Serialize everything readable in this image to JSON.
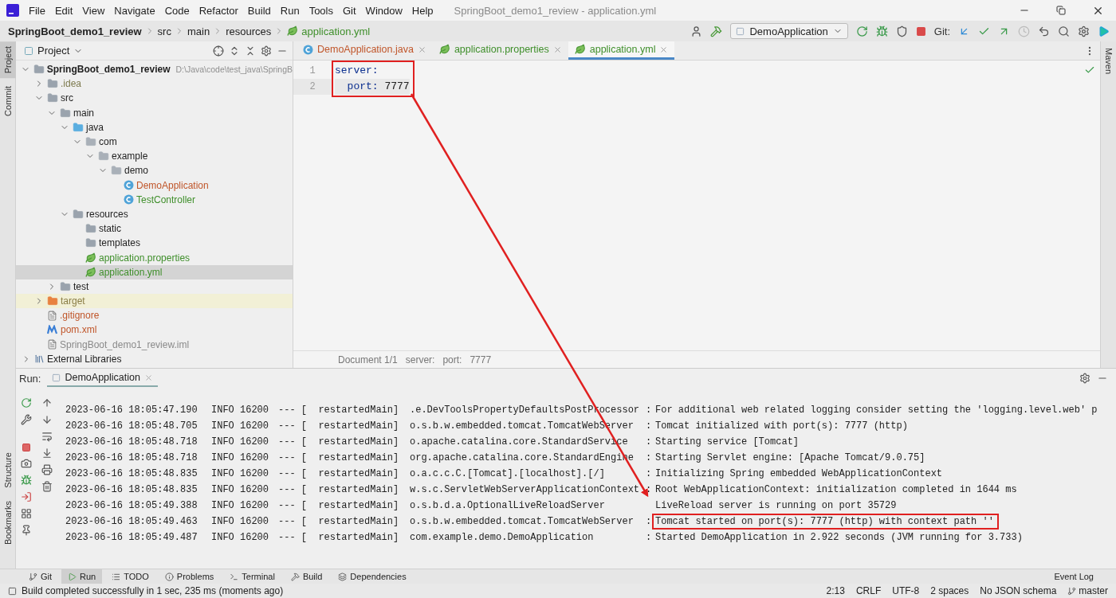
{
  "menu": [
    "File",
    "Edit",
    "View",
    "Navigate",
    "Code",
    "Refactor",
    "Build",
    "Run",
    "Tools",
    "Git",
    "Window",
    "Help"
  ],
  "window": {
    "title": "SpringBoot_demo1_review - application.yml"
  },
  "breadcrumb": [
    {
      "label": "SpringBoot_demo1_review",
      "kind": "project"
    },
    {
      "label": "src",
      "kind": "folder"
    },
    {
      "label": "main",
      "kind": "folder"
    },
    {
      "label": "resources",
      "kind": "folder"
    },
    {
      "label": "application.yml",
      "kind": "config"
    }
  ],
  "toolbar": {
    "run_config": "DemoApplication",
    "git_label": "Git:"
  },
  "left_tools": [
    {
      "label": "Project",
      "selected": true
    },
    {
      "label": "Commit",
      "selected": false
    }
  ],
  "left_tools_bottom": [
    {
      "label": "Structure"
    },
    {
      "label": "Bookmarks"
    }
  ],
  "right_tools": [
    {
      "label": "Maven"
    }
  ],
  "project_panel": {
    "title": "Project",
    "tree": [
      {
        "name": "SpringBoot_demo1_review",
        "path": "D:\\Java\\code\\test_java\\SpringB",
        "kind": "module",
        "expanded": true,
        "selected": false,
        "children": [
          {
            "name": ".idea",
            "kind": "folder",
            "color": "#7d7a4e",
            "expanded": false,
            "selected": false
          },
          {
            "name": "src",
            "kind": "folder",
            "expanded": true,
            "selected": false,
            "children": [
              {
                "name": "main",
                "kind": "folder",
                "expanded": true,
                "selected": false,
                "children": [
                  {
                    "name": "java",
                    "kind": "source",
                    "expanded": true,
                    "selected": false,
                    "children": [
                      {
                        "name": "com",
                        "kind": "package",
                        "expanded": true,
                        "selected": false,
                        "children": [
                          {
                            "name": "example",
                            "kind": "package",
                            "expanded": true,
                            "selected": false,
                            "children": [
                              {
                                "name": "demo",
                                "kind": "package",
                                "expanded": true,
                                "selected": false,
                                "children": [
                                  {
                                    "name": "DemoApplication",
                                    "kind": "class",
                                    "color": "#c0562a",
                                    "selected": false
                                  },
                                  {
                                    "name": "TestController",
                                    "kind": "class",
                                    "color": "#3f8f2b",
                                    "selected": false
                                  }
                                ]
                              }
                            ]
                          }
                        ]
                      }
                    ]
                  },
                  {
                    "name": "resources",
                    "kind": "resources",
                    "expanded": true,
                    "selected": false,
                    "children": [
                      {
                        "name": "static",
                        "kind": "folder",
                        "selected": false
                      },
                      {
                        "name": "templates",
                        "kind": "folder",
                        "selected": false
                      },
                      {
                        "name": "application.properties",
                        "kind": "config",
                        "color": "#3f8f2b",
                        "selected": false
                      },
                      {
                        "name": "application.yml",
                        "kind": "config",
                        "color": "#3f8f2b",
                        "selected": true
                      }
                    ]
                  }
                ]
              },
              {
                "name": "test",
                "kind": "folder",
                "expanded": false,
                "selected": false
              }
            ]
          },
          {
            "name": "target",
            "kind": "excluded",
            "color": "#8a7d45",
            "expanded": false,
            "selected": false
          },
          {
            "name": ".gitignore",
            "kind": "ignore",
            "color": "#c0562a",
            "selected": false
          },
          {
            "name": "pom.xml",
            "kind": "maven",
            "color": "#c0562a",
            "selected": false
          },
          {
            "name": "SpringBoot_demo1_review.iml",
            "kind": "iml",
            "color": "#8a8a8a",
            "selected": false
          }
        ]
      },
      {
        "name": "External Libraries",
        "kind": "libraries",
        "expanded": false,
        "selected": false
      }
    ]
  },
  "editor_tabs": [
    {
      "label": "DemoApplication.java",
      "kind": "class",
      "color": "#c0562a",
      "selected": false
    },
    {
      "label": "application.properties",
      "kind": "config",
      "color": "#3f8f2b",
      "selected": false
    },
    {
      "label": "application.yml",
      "kind": "config",
      "color": "#3f8f2b",
      "selected": true
    }
  ],
  "editor": {
    "lines": [
      {
        "number": "1",
        "key": "server:",
        "current": false
      },
      {
        "number": "2",
        "key": "  port:",
        "value": " 7777",
        "current": true
      }
    ],
    "highlighted": true,
    "path": [
      "Document 1/1",
      "server:",
      "port:",
      "7777"
    ]
  },
  "run_panel": {
    "label": "Run:",
    "tab": "DemoApplication",
    "rows": [
      {
        "time": "2023-06-16 18:05:47.190",
        "level": "INFO",
        "pid": "16200",
        "thread": "--- [  restartedMain]",
        "logger": ".e.DevToolsPropertyDefaultsPostProcessor",
        "sep": ":",
        "message": "For additional web related logging consider setting the 'logging.level.web' p",
        "highlighted": false
      },
      {
        "time": "2023-06-16 18:05:48.705",
        "level": "INFO",
        "pid": "16200",
        "thread": "--- [  restartedMain]",
        "logger": "o.s.b.w.embedded.tomcat.TomcatWebServer",
        "sep": ":",
        "message": "Tomcat initialized with port(s): 7777 (http)",
        "highlighted": false
      },
      {
        "time": "2023-06-16 18:05:48.718",
        "level": "INFO",
        "pid": "16200",
        "thread": "--- [  restartedMain]",
        "logger": "o.apache.catalina.core.StandardService",
        "sep": ":",
        "message": "Starting service [Tomcat]",
        "highlighted": false
      },
      {
        "time": "2023-06-16 18:05:48.718",
        "level": "INFO",
        "pid": "16200",
        "thread": "--- [  restartedMain]",
        "logger": "org.apache.catalina.core.StandardEngine",
        "sep": ":",
        "message": "Starting Servlet engine: [Apache Tomcat/9.0.75]",
        "highlighted": false
      },
      {
        "time": "2023-06-16 18:05:48.835",
        "level": "INFO",
        "pid": "16200",
        "thread": "--- [  restartedMain]",
        "logger": "o.a.c.c.C.[Tomcat].[localhost].[/]",
        "sep": ":",
        "message": "Initializing Spring embedded WebApplicationContext",
        "highlighted": false
      },
      {
        "time": "2023-06-16 18:05:48.835",
        "level": "INFO",
        "pid": "16200",
        "thread": "--- [  restartedMain]",
        "logger": "w.s.c.ServletWebServerApplicationContext",
        "sep": ":",
        "message": "Root WebApplicationContext: initialization completed in 1644 ms",
        "highlighted": false
      },
      {
        "time": "2023-06-16 18:05:49.388",
        "level": "INFO",
        "pid": "16200",
        "thread": "--- [  restartedMain]",
        "logger": "o.s.b.d.a.OptionalLiveReloadServer",
        "message": "LiveReload server is running on port 35729",
        "highlighted": false
      },
      {
        "time": "2023-06-16 18:05:49.463",
        "level": "INFO",
        "pid": "16200",
        "thread": "--- [  restartedMain]",
        "logger": "o.s.b.w.embedded.tomcat.TomcatWebServer",
        "sep": ":",
        "message": "Tomcat started on port(s): 7777 (http) with context path ''",
        "highlighted": true
      },
      {
        "time": "2023-06-16 18:05:49.487",
        "level": "INFO",
        "pid": "16200",
        "thread": "--- [  restartedMain]",
        "logger": "com.example.demo.DemoApplication",
        "sep": ":",
        "message": "Started DemoApplication in 2.922 seconds (JVM running for 3.733)",
        "highlighted": false
      }
    ]
  },
  "tool_tabs": [
    {
      "label": "Git",
      "kind": "git",
      "selected": false
    },
    {
      "label": "Run",
      "kind": "run",
      "selected": true
    },
    {
      "label": "TODO",
      "kind": "todo",
      "selected": false
    },
    {
      "label": "Problems",
      "kind": "problems",
      "selected": false
    },
    {
      "label": "Terminal",
      "kind": "terminal",
      "selected": false
    },
    {
      "label": "Build",
      "kind": "build",
      "selected": false
    },
    {
      "label": "Dependencies",
      "kind": "dependencies",
      "selected": false
    }
  ],
  "event_log": "Event Log",
  "status_bar": {
    "message": "Build completed successfully in 1 sec, 235 ms (moments ago)",
    "items": [
      "2:13",
      "CRLF",
      "UTF-8",
      "2 spaces",
      "No JSON schema"
    ],
    "branch": "master"
  }
}
